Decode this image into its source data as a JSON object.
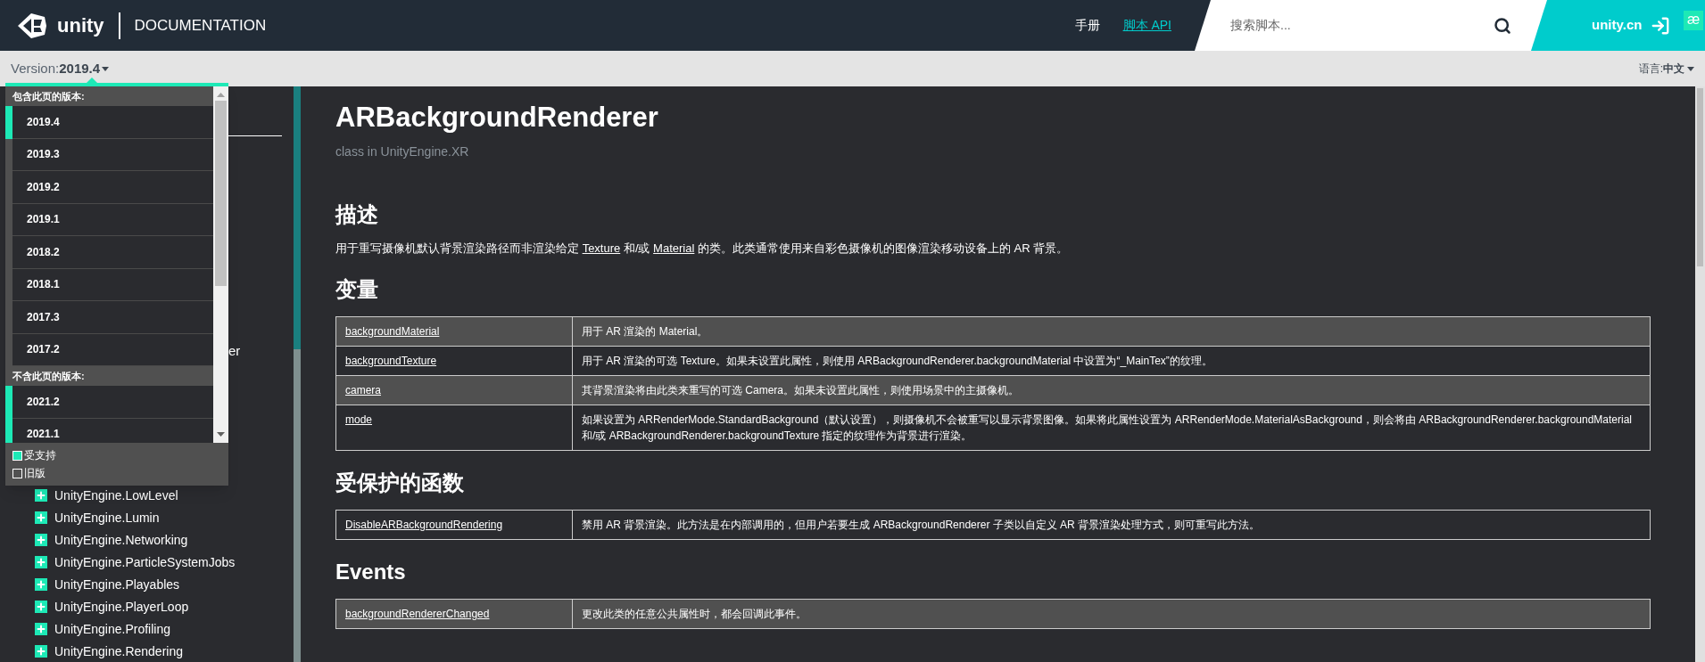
{
  "header": {
    "brand": "unity",
    "section": "DOCUMENTATION",
    "nav": [
      {
        "label": "手册",
        "selected": false
      },
      {
        "label": "脚本 API",
        "selected": true
      }
    ],
    "search": {
      "placeholder": "搜索脚本..."
    },
    "site_link": "unity.cn",
    "extension_badge": "æ"
  },
  "subbar": {
    "version_label": "Version: ",
    "version": "2019.4",
    "language_label": "语言: ",
    "language": "中文"
  },
  "version_menu": {
    "groups": [
      {
        "title": "包含此页的版本:",
        "items": [
          {
            "label": "2019.4",
            "supported": true
          },
          {
            "label": "2019.3",
            "supported": false
          },
          {
            "label": "2019.2",
            "supported": false
          },
          {
            "label": "2019.1",
            "supported": false
          },
          {
            "label": "2018.2",
            "supported": false
          },
          {
            "label": "2018.1",
            "supported": false
          },
          {
            "label": "2017.3",
            "supported": false
          },
          {
            "label": "2017.2",
            "supported": false
          }
        ]
      },
      {
        "title": "不含此页的版本:",
        "items": [
          {
            "label": "2021.2",
            "supported": true
          },
          {
            "label": "2021.1",
            "supported": true
          }
        ]
      }
    ],
    "legend": [
      {
        "label": "受支持",
        "checked": true
      },
      {
        "label": "旧版",
        "checked": false
      }
    ]
  },
  "sidebar": {
    "partial_item": "er",
    "items": [
      {
        "label": "UnityEngine.LowLevel",
        "expanded": false
      },
      {
        "label": "UnityEngine.Lumin",
        "expanded": false
      },
      {
        "label": "UnityEngine.Networking",
        "expanded": false
      },
      {
        "label": "UnityEngine.ParticleSystemJobs",
        "expanded": false
      },
      {
        "label": "UnityEngine.Playables",
        "expanded": false
      },
      {
        "label": "UnityEngine.PlayerLoop",
        "expanded": false
      },
      {
        "label": "UnityEngine.Profiling",
        "expanded": false
      },
      {
        "label": "UnityEngine.Rendering",
        "expanded": false
      }
    ]
  },
  "content": {
    "title": "ARBackgroundRenderer",
    "subtitle": "class in UnityEngine.XR",
    "description_heading": "描述",
    "description": [
      {
        "text": "用于重写摄像机默认背景渲染路径而非渲染给定 ",
        "link": false
      },
      {
        "text": "Texture",
        "link": true
      },
      {
        "text": " 和/或 ",
        "link": false
      },
      {
        "text": "Material",
        "link": true
      },
      {
        "text": " 的类。此类通常使用来自彩色摄像机的图像渲染移动设备上的 AR 背景。",
        "link": false
      }
    ],
    "sections": [
      {
        "heading": "变量",
        "rows": [
          {
            "name": "backgroundMaterial",
            "description": "用于 AR 渲染的 Material。",
            "highlighted": true
          },
          {
            "name": "backgroundTexture",
            "description": "用于 AR 渲染的可选 Texture。如果未设置此属性，则使用 ARBackgroundRenderer.backgroundMaterial 中设置为“_MainTex”的纹理。",
            "highlighted": false
          },
          {
            "name": "camera",
            "description": "其背景渲染将由此类来重写的可选 Camera。如果未设置此属性，则使用场景中的主摄像机。",
            "highlighted": true
          },
          {
            "name": "mode",
            "description": "如果设置为 ARRenderMode.StandardBackground（默认设置），则摄像机不会被重写以显示背景图像。如果将此属性设置为 ARRenderMode.MaterialAsBackground，则会将由 ARBackgroundRenderer.backgroundMaterial 和/或 ARBackgroundRenderer.backgroundTexture 指定的纹理作为背景进行渲染。",
            "highlighted": false
          }
        ]
      },
      {
        "heading": "受保护的函数",
        "rows": [
          {
            "name": "DisableARBackgroundRendering",
            "description": "禁用 AR 背景渲染。此方法是在内部调用的，但用户若要生成 ARBackgroundRenderer 子类以自定义 AR 背景渲染处理方式，则可重写此方法。",
            "highlighted": false
          }
        ]
      },
      {
        "heading": "Events",
        "rows": [
          {
            "name": "backgroundRendererChanged",
            "description": "更改此类的任意公共属性时，都会回调此事件。",
            "highlighted": true
          }
        ]
      }
    ]
  }
}
